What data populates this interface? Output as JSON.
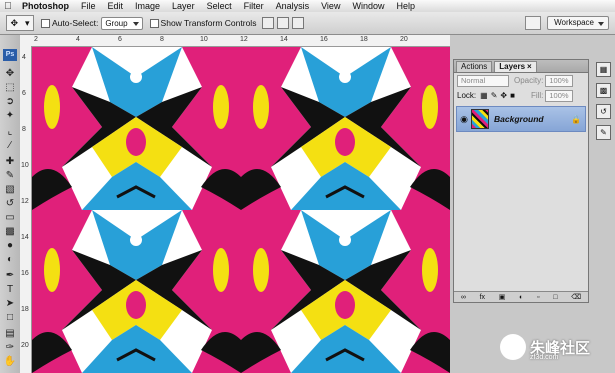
{
  "menubar": {
    "app_name": "Photoshop",
    "items": [
      "File",
      "Edit",
      "Image",
      "Layer",
      "Select",
      "Filter",
      "Analysis",
      "View",
      "Window",
      "Help"
    ]
  },
  "options_bar": {
    "auto_select_label": "Auto-Select:",
    "auto_select_value": "Group",
    "show_transform_label": "Show Transform Controls",
    "workspace_label": "Workspace"
  },
  "toolbox": {
    "logo": "Ps",
    "tools": [
      "move-icon",
      "marquee-icon",
      "lasso-icon",
      "magic-wand-icon",
      "crop-icon",
      "slice-icon",
      "healing-icon",
      "brush-icon",
      "clone-stamp-icon",
      "history-brush-icon",
      "eraser-icon",
      "gradient-icon",
      "blur-icon",
      "dodge-icon",
      "pen-icon",
      "type-icon",
      "path-select-icon",
      "shape-icon",
      "notes-icon",
      "eyedropper-icon",
      "hand-icon",
      "zoom-icon"
    ]
  },
  "ruler": {
    "top_numbers": [
      "2",
      "4",
      "6",
      "8",
      "10",
      "12",
      "14",
      "16",
      "18",
      "20"
    ],
    "left_numbers": [
      "4",
      "6",
      "8",
      "10",
      "12",
      "14",
      "16",
      "18",
      "20"
    ]
  },
  "layers_panel": {
    "tabs": [
      "Actions",
      "Layers"
    ],
    "blend_mode": "Normal",
    "opacity_label": "Opacity:",
    "opacity_value": "100%",
    "lock_label": "Lock:",
    "fill_label": "Fill:",
    "fill_value": "100%",
    "layer_name": "Background"
  },
  "watermark": {
    "text": "朱峰社区",
    "url": "zf3d.com"
  },
  "colors": {
    "magenta": "#e0207a",
    "cyan": "#28a0d8",
    "yellow": "#f4e012",
    "black": "#111111",
    "selection_blue": "#86a5d6"
  }
}
